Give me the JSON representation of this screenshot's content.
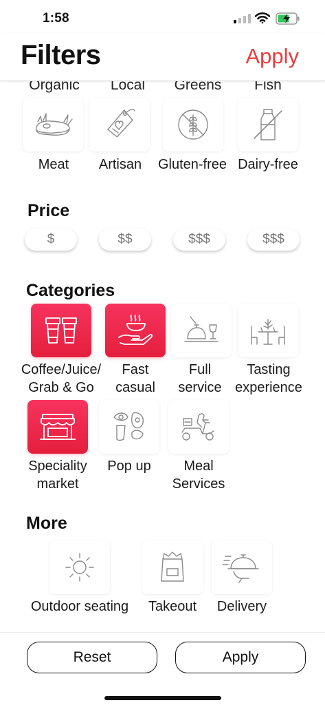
{
  "status_bar": {
    "time": "1:58"
  },
  "header": {
    "title": "Filters",
    "apply_label": "Apply"
  },
  "partial_row": [
    "Organic",
    "Local",
    "Greens",
    "Fish"
  ],
  "diet": {
    "items": [
      {
        "label": "Meat",
        "icon": "meat-icon",
        "selected": false
      },
      {
        "label": "Artisan",
        "icon": "artisan-tag-icon",
        "selected": false
      },
      {
        "label": "Gluten-free",
        "icon": "gluten-free-icon",
        "selected": false
      },
      {
        "label": "Dairy-free",
        "icon": "dairy-free-icon",
        "selected": false
      }
    ]
  },
  "price": {
    "title": "Price",
    "options": [
      "$",
      "$$",
      "$$$",
      "$$$"
    ]
  },
  "categories": {
    "title": "Categories",
    "items": [
      {
        "label_line1": "Coffee/Juice/",
        "label_line2": "Grab & Go",
        "icon": "coffee-cups-icon",
        "selected": true
      },
      {
        "label_line1": "Fast",
        "label_line2": "casual",
        "icon": "hand-food-icon",
        "selected": true
      },
      {
        "label_line1": "Full",
        "label_line2": "service",
        "icon": "cloche-wine-icon",
        "selected": false
      },
      {
        "label_line1": "Tasting",
        "label_line2": "experience",
        "icon": "dining-table-icon",
        "selected": false
      },
      {
        "label_line1": "Speciality",
        "label_line2": "market",
        "icon": "storefront-icon",
        "selected": true
      },
      {
        "label_line1": "Pop up",
        "label_line2": "",
        "icon": "pop-up-icon",
        "selected": false
      },
      {
        "label_line1": "Meal",
        "label_line2": "Services",
        "icon": "scooter-icon",
        "selected": false
      }
    ]
  },
  "more": {
    "title": "More",
    "items": [
      {
        "label": "Outdoor seating",
        "icon": "sun-icon",
        "selected": false
      },
      {
        "label": "Takeout",
        "icon": "takeout-bag-icon",
        "selected": false
      },
      {
        "label": "Delivery",
        "icon": "delivery-cloche-icon",
        "selected": false
      }
    ]
  },
  "footer": {
    "reset_label": "Reset",
    "apply_label": "Apply"
  },
  "colors": {
    "accent": "#ee3a3a",
    "selected_tile": "#e41f3d",
    "icon_stroke": "#8a8a8a"
  }
}
